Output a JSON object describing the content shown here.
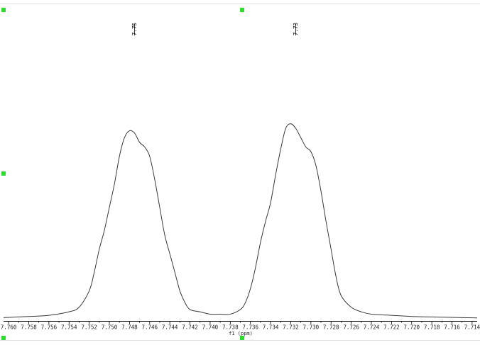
{
  "chart_data": {
    "type": "line",
    "title": "",
    "xlabel": "f1 (ppm)",
    "ylabel": "",
    "x_reversed": true,
    "xlim": [
      7.7605,
      7.7135
    ],
    "ylim": [
      0,
      1.19
    ],
    "grid": false,
    "x_ticks": [
      7.76,
      7.758,
      7.756,
      7.754,
      7.752,
      7.75,
      7.748,
      7.746,
      7.744,
      7.742,
      7.74,
      7.738,
      7.736,
      7.734,
      7.732,
      7.73,
      7.728,
      7.726,
      7.724,
      7.722,
      7.72,
      7.718,
      7.716,
      7.714
    ],
    "x_tick_labels": [
      "7.760",
      "7.758",
      "7.756",
      "7.754",
      "7.752",
      "7.750",
      "7.748",
      "7.746",
      "7.744",
      "7.742",
      "7.740",
      "7.738",
      "7.736",
      "7.734",
      "7.732",
      "7.730",
      "7.728",
      "7.726",
      "7.724",
      "7.722",
      "7.720",
      "7.718",
      "7.716",
      "7.714"
    ],
    "peak_labels": [
      {
        "ppm": 7.7475,
        "text": "7.75"
      },
      {
        "ppm": 7.7315,
        "text": "7.73"
      }
    ],
    "series": [
      {
        "x": [
          7.7605,
          7.758,
          7.756,
          7.754,
          7.753,
          7.752,
          7.7515,
          7.751,
          7.7505,
          7.75,
          7.7495,
          7.749,
          7.7485,
          7.748,
          7.7475,
          7.747,
          7.7465,
          7.746,
          7.7455,
          7.745,
          7.7445,
          7.744,
          7.7435,
          7.743,
          7.7425,
          7.742,
          7.741,
          7.74,
          7.739,
          7.738,
          7.737,
          7.7365,
          7.736,
          7.7355,
          7.735,
          7.7345,
          7.734,
          7.7335,
          7.733,
          7.7325,
          7.732,
          7.7315,
          7.731,
          7.7305,
          7.73,
          7.7295,
          7.729,
          7.7285,
          7.728,
          7.7275,
          7.727,
          7.726,
          7.725,
          7.724,
          7.722,
          7.72,
          7.718,
          7.716,
          7.7135
        ],
        "y": [
          0.005,
          0.01,
          0.015,
          0.03,
          0.05,
          0.12,
          0.2,
          0.3,
          0.38,
          0.48,
          0.58,
          0.7,
          0.78,
          0.81,
          0.8,
          0.76,
          0.74,
          0.7,
          0.6,
          0.48,
          0.36,
          0.28,
          0.2,
          0.12,
          0.07,
          0.04,
          0.03,
          0.02,
          0.02,
          0.02,
          0.04,
          0.07,
          0.13,
          0.22,
          0.33,
          0.42,
          0.5,
          0.62,
          0.73,
          0.82,
          0.84,
          0.82,
          0.78,
          0.74,
          0.72,
          0.66,
          0.55,
          0.42,
          0.3,
          0.18,
          0.1,
          0.05,
          0.03,
          0.02,
          0.015,
          0.01,
          0.008,
          0.006,
          0.004
        ]
      }
    ]
  },
  "colors": {
    "handle": "#2ddc2d",
    "trace": "#3a3a3a",
    "axis": "#000000",
    "border": "#e2e2e2"
  }
}
